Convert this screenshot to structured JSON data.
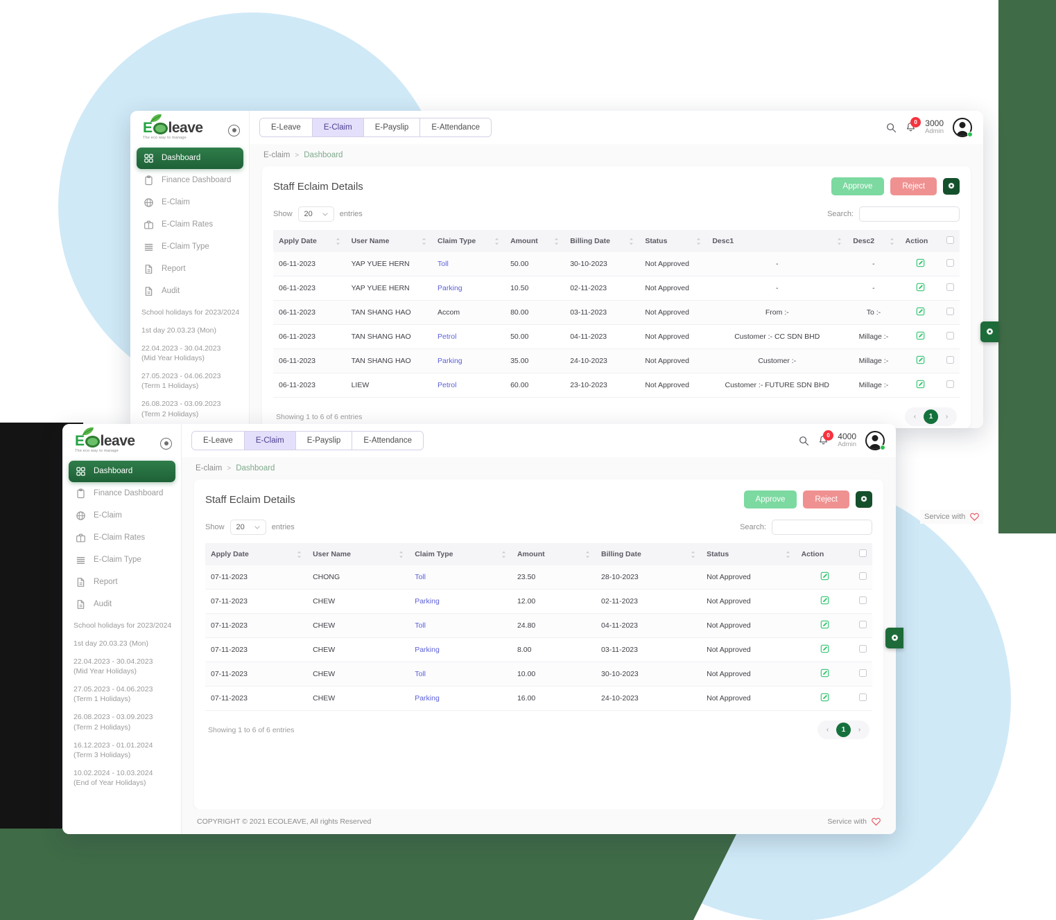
{
  "brand": {
    "name_prefix": "E",
    "name_suffix": "leave",
    "tagline": "The eco way to manage"
  },
  "colors": {
    "primary_green": "#1d6b39",
    "accent_green": "#2f7d4a",
    "approve": "#7cd9a0",
    "reject": "#f09191",
    "tab_active_bg": "#e4dffa",
    "link": "#5b5fd6",
    "badge_red": "#f5333f",
    "bg_circle": "#cfe9f7",
    "dark_panel": "#3f6b47"
  },
  "sidebar": {
    "items": [
      {
        "label": "Dashboard",
        "icon": "grid-icon",
        "active": true
      },
      {
        "label": "Finance Dashboard",
        "icon": "clipboard-icon",
        "active": false
      },
      {
        "label": "E-Claim",
        "icon": "globe-icon",
        "active": false
      },
      {
        "label": "E-Claim Rates",
        "icon": "briefcase-icon",
        "active": false
      },
      {
        "label": "E-Claim Type",
        "icon": "list-icon",
        "active": false
      },
      {
        "label": "Report",
        "icon": "document-icon",
        "active": false
      },
      {
        "label": "Audit",
        "icon": "document-icon",
        "active": false
      }
    ],
    "holidays_title": "School holidays for 2023/2024",
    "holidays": [
      "1st day 20.03.23 (Mon)",
      "22.04.2023 - 30.04.2023\n(Mid Year Holidays)",
      "27.05.2023 - 04.06.2023\n(Term 1 Holidays)",
      "26.08.2023 - 03.09.2023\n(Term 2 Holidays)",
      "16.12.2023 - 01.01.2024\n(Term 3 Holidays)",
      "10.02.2024 - 10.03.2024\n(End of Year Holidays)"
    ]
  },
  "tabs": [
    {
      "label": "E-Leave",
      "active": false
    },
    {
      "label": "E-Claim",
      "active": true
    },
    {
      "label": "E-Payslip",
      "active": false
    },
    {
      "label": "E-Attendance",
      "active": false
    }
  ],
  "breadcrumb": {
    "root": "E-claim",
    "separator": ">",
    "current": "Dashboard"
  },
  "card": {
    "title": "Staff Eclaim Details",
    "approve_label": "Approve",
    "reject_label": "Reject",
    "gear_icon": "gear-icon"
  },
  "controls": {
    "show_label": "Show",
    "entries_label": "entries",
    "page_size": "20",
    "search_label": "Search:",
    "search_value": "",
    "search_placeholder": ""
  },
  "footer": {
    "copyright": "COPYRIGHT © 2021 ECOLEAVE, All rights Reserved",
    "service_text": "Service with",
    "heart_icon": "heart-icon"
  },
  "window_back": {
    "user": {
      "id": "3000",
      "role": "Admin",
      "notifications": "0"
    },
    "table": {
      "columns": [
        "Apply Date",
        "User Name",
        "Claim Type",
        "Amount",
        "Billing Date",
        "Status",
        "Desc1",
        "Desc2",
        "Action"
      ],
      "rows": [
        {
          "apply_date": "06-11-2023",
          "user_name": "YAP YUEE HERN",
          "claim_type": "Toll",
          "link": true,
          "amount": "50.00",
          "billing_date": "30-10-2023",
          "status": "Not Approved",
          "desc1": "-",
          "desc2": "-"
        },
        {
          "apply_date": "06-11-2023",
          "user_name": "YAP YUEE HERN",
          "claim_type": "Parking",
          "link": true,
          "amount": "10.50",
          "billing_date": "02-11-2023",
          "status": "Not Approved",
          "desc1": "-",
          "desc2": "-"
        },
        {
          "apply_date": "06-11-2023",
          "user_name": "TAN SHANG HAO",
          "claim_type": "Accom",
          "link": false,
          "amount": "80.00",
          "billing_date": "03-11-2023",
          "status": "Not Approved",
          "desc1": "From :-",
          "desc2": "To :-"
        },
        {
          "apply_date": "06-11-2023",
          "user_name": "TAN SHANG HAO",
          "claim_type": "Petrol",
          "link": true,
          "amount": "50.00",
          "billing_date": "04-11-2023",
          "status": "Not Approved",
          "desc1": "Customer :- CC SDN BHD",
          "desc2": "Millage :-"
        },
        {
          "apply_date": "06-11-2023",
          "user_name": "TAN SHANG HAO",
          "claim_type": "Parking",
          "link": true,
          "amount": "35.00",
          "billing_date": "24-10-2023",
          "status": "Not Approved",
          "desc1": "Customer :-",
          "desc2": "Millage :-"
        },
        {
          "apply_date": "06-11-2023",
          "user_name": "LIEW",
          "claim_type": "Petrol",
          "link": true,
          "amount": "60.00",
          "billing_date": "23-10-2023",
          "status": "Not Approved",
          "desc1": "Customer :- FUTURE SDN BHD",
          "desc2": "Millage :-"
        }
      ]
    },
    "showing": "Showing 1 to 6 of 6 entries",
    "page_current": "1"
  },
  "window_front": {
    "user": {
      "id": "4000",
      "role": "Admin",
      "notifications": "0"
    },
    "table": {
      "columns": [
        "Apply Date",
        "User Name",
        "Claim Type",
        "Amount",
        "Billing Date",
        "Status",
        "Action"
      ],
      "rows": [
        {
          "apply_date": "07-11-2023",
          "user_name": "CHONG",
          "claim_type": "Toll",
          "link": true,
          "amount": "23.50",
          "billing_date": "28-10-2023",
          "status": "Not Approved"
        },
        {
          "apply_date": "07-11-2023",
          "user_name": "CHEW",
          "claim_type": "Parking",
          "link": true,
          "amount": "12.00",
          "billing_date": "02-11-2023",
          "status": "Not Approved"
        },
        {
          "apply_date": "07-11-2023",
          "user_name": "CHEW",
          "claim_type": "Toll",
          "link": true,
          "amount": "24.80",
          "billing_date": "04-11-2023",
          "status": "Not Approved"
        },
        {
          "apply_date": "07-11-2023",
          "user_name": "CHEW",
          "claim_type": "Parking",
          "link": true,
          "amount": "8.00",
          "billing_date": "03-11-2023",
          "status": "Not Approved"
        },
        {
          "apply_date": "07-11-2023",
          "user_name": "CHEW",
          "claim_type": "Toll",
          "link": true,
          "amount": "10.00",
          "billing_date": "30-10-2023",
          "status": "Not Approved"
        },
        {
          "apply_date": "07-11-2023",
          "user_name": "CHEW",
          "claim_type": "Parking",
          "link": true,
          "amount": "16.00",
          "billing_date": "24-10-2023",
          "status": "Not Approved"
        }
      ]
    },
    "showing": "Showing 1 to 6 of 6 entries",
    "page_current": "1"
  }
}
